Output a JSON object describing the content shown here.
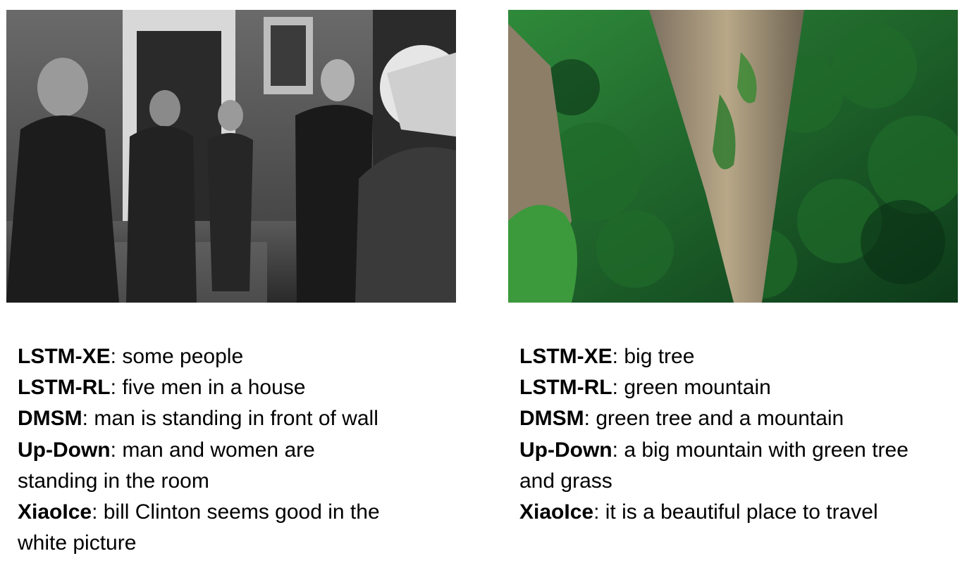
{
  "panels": [
    {
      "image": {
        "description_icon": "photo-icon",
        "colors": {
          "tone": "grayscale"
        }
      },
      "captions": [
        {
          "model": "LSTM-XE",
          "sep": ": ",
          "text": "some people"
        },
        {
          "model": "LSTM-RL",
          "sep": ": ",
          "text": "five men in a house"
        },
        {
          "model": "DMSM",
          "sep": ": ",
          "text": "man is standing in front of wall"
        },
        {
          "model": "Up-Down",
          "sep": ": ",
          "text": "man and women are standing in the room"
        },
        {
          "model": "XiaoIce",
          "sep": ": ",
          "text": "bill Clinton seems good in the white picture"
        }
      ]
    },
    {
      "image": {
        "description_icon": "photo-icon",
        "colors": {
          "forest": "#1f6b2a",
          "rock": "#a89878"
        }
      },
      "captions": [
        {
          "model": "LSTM-XE",
          "sep": ": ",
          "text": "big tree"
        },
        {
          "model": "LSTM-RL",
          "sep": ": ",
          "text": "green mountain"
        },
        {
          "model": "DMSM",
          "sep": ": ",
          "text": "green tree and a mountain"
        },
        {
          "model": "Up-Down",
          "sep": ": ",
          "text": "a big mountain with green tree and grass"
        },
        {
          "model": "XiaoIce",
          "sep": ": ",
          "text": "it is a beautiful place to travel"
        }
      ]
    }
  ]
}
